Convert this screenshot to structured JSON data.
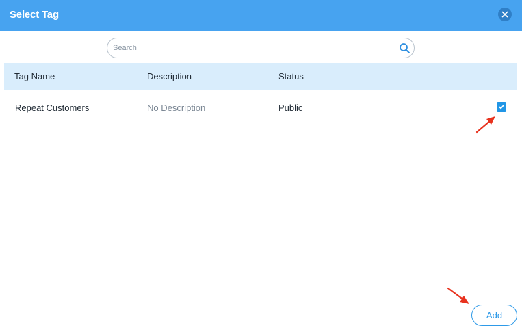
{
  "dialog": {
    "title": "Select Tag",
    "close_icon": "close-icon"
  },
  "search": {
    "placeholder": "Search",
    "value": "",
    "icon": "search-icon"
  },
  "table": {
    "columns": [
      "Tag Name",
      "Description",
      "Status"
    ],
    "rows": [
      {
        "tag_name": "Repeat Customers",
        "description": "No Description",
        "status": "Public",
        "checked": true
      }
    ]
  },
  "footer": {
    "add_label": "Add"
  },
  "colors": {
    "header": "#47a3f0",
    "table_header": "#d9edfc",
    "accent": "#2196e6",
    "annotation": "#e8321e"
  }
}
